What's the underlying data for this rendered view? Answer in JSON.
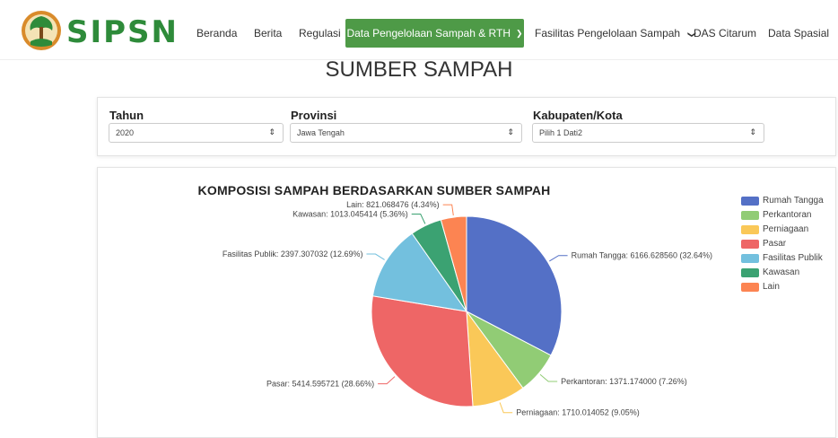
{
  "brand": {
    "name": "SIPSN",
    "logo_icon": "sipsn-tree-logo-icon"
  },
  "nav": {
    "items": [
      {
        "label": "Beranda"
      },
      {
        "label": "Berita"
      },
      {
        "label": "Regulasi"
      },
      {
        "label": "Data Pengelolaan Sampah & RTH",
        "active": true,
        "has_dropdown": true
      },
      {
        "label": "Fasilitas Pengelolaan Sampah",
        "has_dropdown": true
      },
      {
        "label": "DAS Citarum"
      },
      {
        "label": "Data Spasial"
      }
    ],
    "active_color": "#4e9a47"
  },
  "page": {
    "title": "SUMBER SAMPAH"
  },
  "filters": {
    "tahun": {
      "label": "Tahun",
      "value": "2020"
    },
    "provinsi": {
      "label": "Provinsi",
      "value": "Jawa Tengah"
    },
    "kabupaten": {
      "label": "Kabupaten/Kota",
      "value": "Pilih 1 Dati2"
    }
  },
  "chart_data": {
    "type": "pie",
    "title": "KOMPOSISI SAMPAH BERDASARKAN SUMBER SAMPAH",
    "legend_position": "top-right",
    "slices": [
      {
        "name": "Rumah Tangga",
        "value": 6166.62856,
        "percent": 32.64,
        "label": "Rumah Tangga: 6166.628560 (32.64%)",
        "color": "#5470c6"
      },
      {
        "name": "Perkantoran",
        "value": 1371.174,
        "percent": 7.26,
        "label": "Perkantoran: 1371.174000 (7.26%)",
        "color": "#91cc75"
      },
      {
        "name": "Perniagaan",
        "value": 1710.014052,
        "percent": 9.05,
        "label": "Perniagaan: 1710.014052 (9.05%)",
        "color": "#fac858"
      },
      {
        "name": "Pasar",
        "value": 5414.595721,
        "percent": 28.66,
        "label": "Pasar: 5414.595721 (28.66%)",
        "color": "#ee6666"
      },
      {
        "name": "Fasilitas Publik",
        "value": 2397.307032,
        "percent": 12.69,
        "label": "Fasilitas Publik: 2397.307032 (12.69%)",
        "color": "#73c0de"
      },
      {
        "name": "Kawasan",
        "value": 1013.045414,
        "percent": 5.36,
        "label": "Kawasan: 1013.045414 (5.36%)",
        "color": "#3ba272"
      },
      {
        "name": "Lain",
        "value": 821.068476,
        "percent": 4.34,
        "label": "Lain: 821.068476 (4.34%)",
        "color": "#fc8452"
      }
    ]
  }
}
